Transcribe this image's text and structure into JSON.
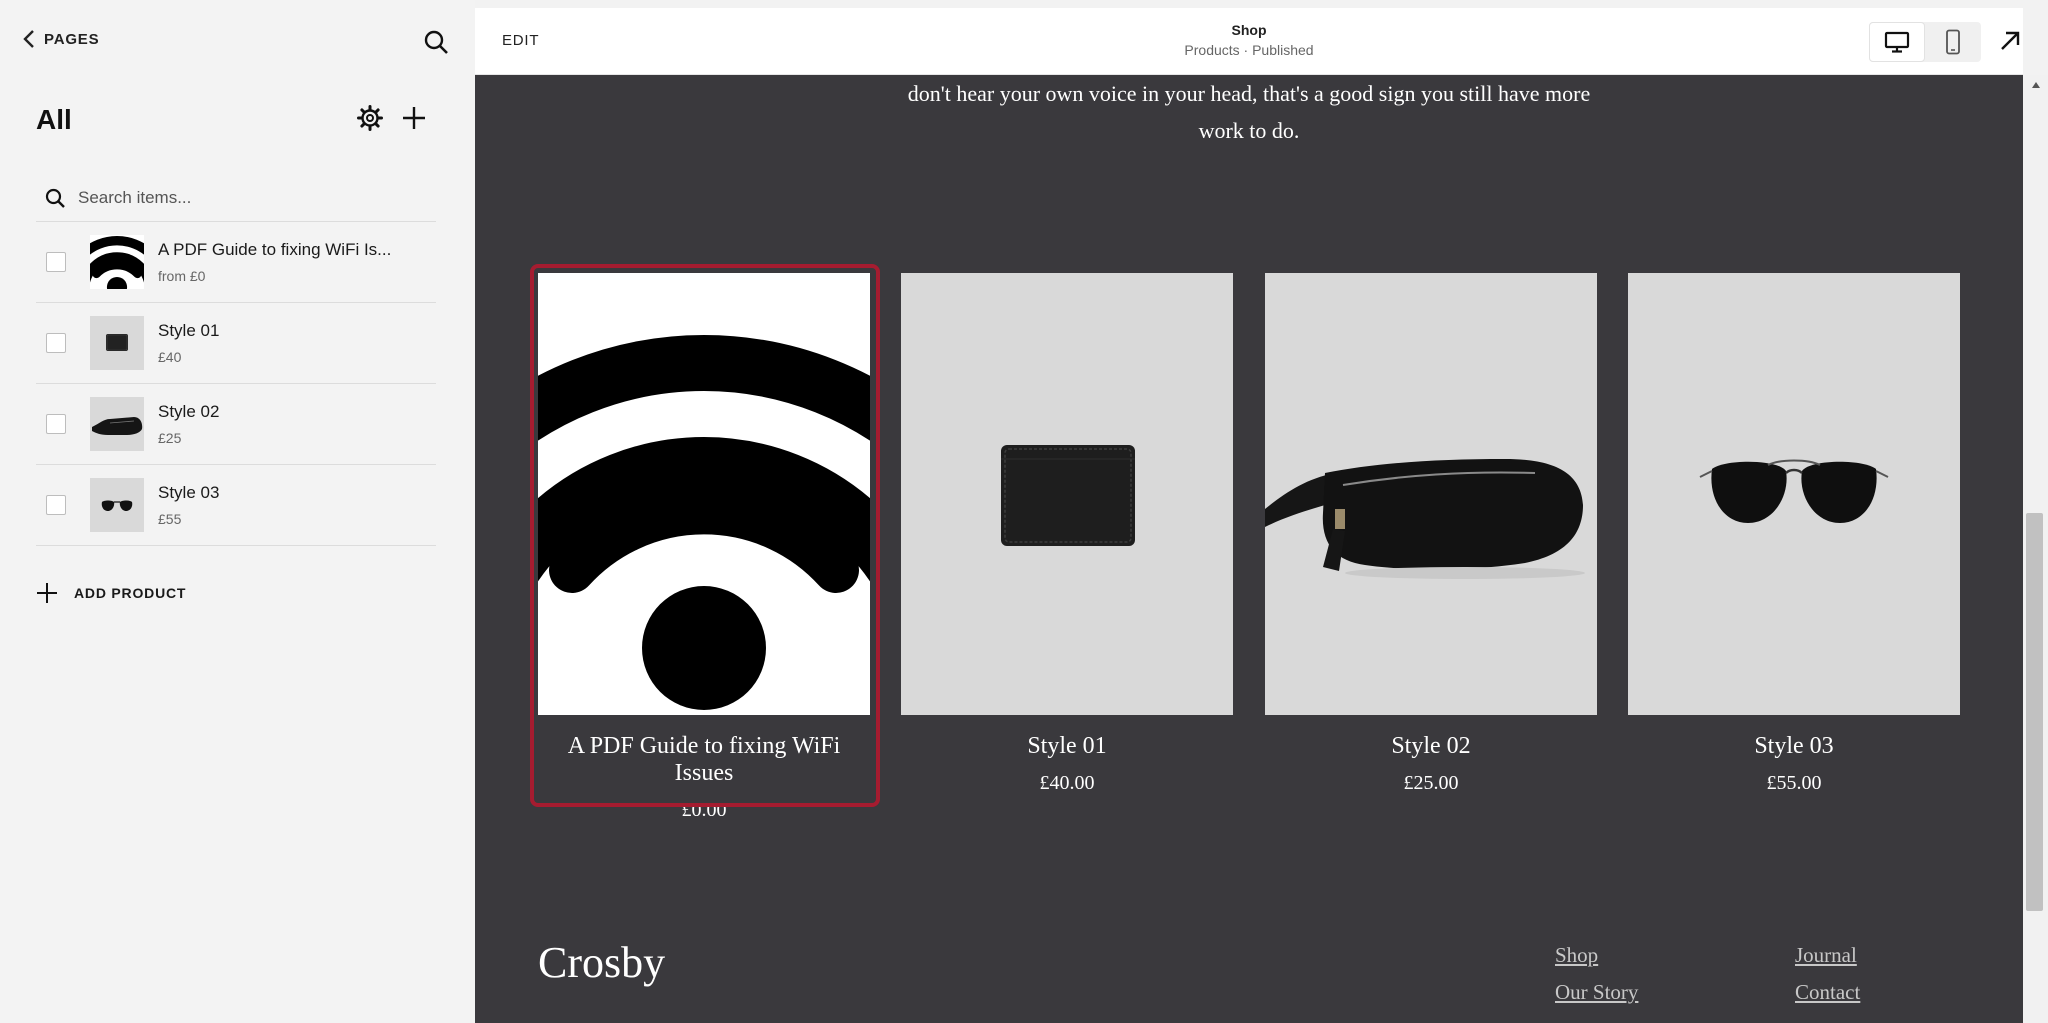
{
  "sidebar": {
    "back_label": "PAGES",
    "title": "All",
    "search_placeholder": "Search items...",
    "items": [
      {
        "name": "A PDF Guide to fixing WiFi Is...",
        "price": "from £0",
        "thumb": "wifi-icon"
      },
      {
        "name": "Style 01",
        "price": "£40",
        "thumb": "wallet"
      },
      {
        "name": "Style 02",
        "price": "£25",
        "thumb": "belt-bag"
      },
      {
        "name": "Style 03",
        "price": "£55",
        "thumb": "sunglasses"
      }
    ],
    "add_product_label": "ADD PRODUCT"
  },
  "topbar": {
    "edit_label": "EDIT",
    "page_title": "Shop",
    "page_subtitle": "Products · Published",
    "devices": [
      "desktop-icon",
      "mobile-icon"
    ],
    "active_device": "desktop"
  },
  "preview": {
    "intro_line1": "don't hear your own voice in your head, that's a good sign you still have more",
    "intro_line2": "work to do.",
    "products": [
      {
        "name": "A PDF Guide to fixing WiFi Issues",
        "price": "£0.00",
        "selected": true
      },
      {
        "name": "Style 01",
        "price": "£40.00"
      },
      {
        "name": "Style 02",
        "price": "£25.00"
      },
      {
        "name": "Style 03",
        "price": "£55.00"
      }
    ],
    "brand": "Crosby",
    "footer_links": [
      "Shop",
      "Journal",
      "Our Story",
      "Contact"
    ]
  },
  "colors": {
    "preview_bg": "#3a393d",
    "selected_border": "#a51c30",
    "product_bg": "#d9d9d9"
  }
}
